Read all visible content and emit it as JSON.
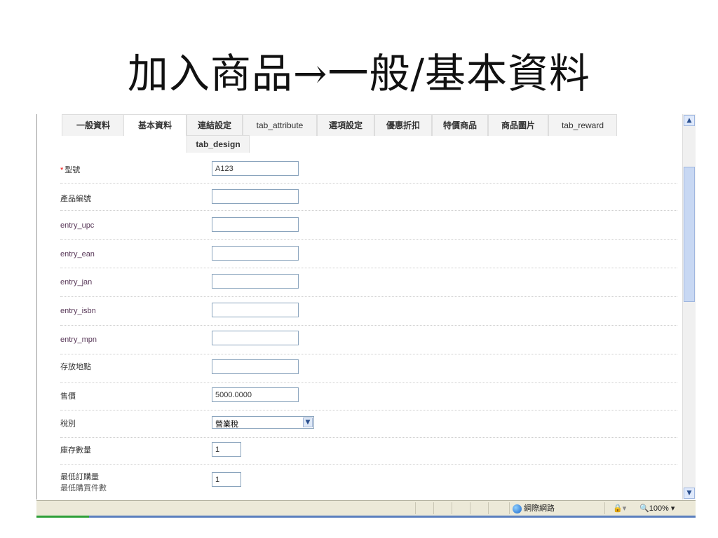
{
  "slide": {
    "title": "加入商品→一般/基本資料"
  },
  "tabs": [
    {
      "label": "一般資料"
    },
    {
      "label": "基本資料"
    },
    {
      "label": "連結設定"
    },
    {
      "label": "tab_attribute"
    },
    {
      "label": "選項設定"
    },
    {
      "label": "優惠折扣"
    },
    {
      "label": "特價商品"
    },
    {
      "label": "商品圖片"
    },
    {
      "label": "tab_reward"
    },
    {
      "label": "tab_design"
    }
  ],
  "form": {
    "model": {
      "required_mark": "*",
      "label": "型號",
      "value": "A123"
    },
    "sku": {
      "label": "產品編號",
      "value": ""
    },
    "upc": {
      "label": "entry_upc",
      "value": ""
    },
    "ean": {
      "label": "entry_ean",
      "value": ""
    },
    "jan": {
      "label": "entry_jan",
      "value": ""
    },
    "isbn": {
      "label": "entry_isbn",
      "value": ""
    },
    "mpn": {
      "label": "entry_mpn",
      "value": ""
    },
    "location": {
      "label": "存放地點",
      "value": ""
    },
    "price": {
      "label": "售價",
      "value": "5000.0000"
    },
    "tax_class": {
      "label": "稅別",
      "value": "營業稅"
    },
    "quantity": {
      "label": "庫存數量",
      "value": "1"
    },
    "minimum": {
      "label": "最低訂購量",
      "sublabel": "最低購買件數",
      "value": "1"
    }
  },
  "status_bar": {
    "zone": "網際網路",
    "zoom": "100%",
    "zoom_icon": "magnifier-icon",
    "globe_icon": "globe-icon"
  },
  "scrollbar": {
    "up_icon": "scroll-up-icon",
    "down_icon": "scroll-down-icon"
  }
}
